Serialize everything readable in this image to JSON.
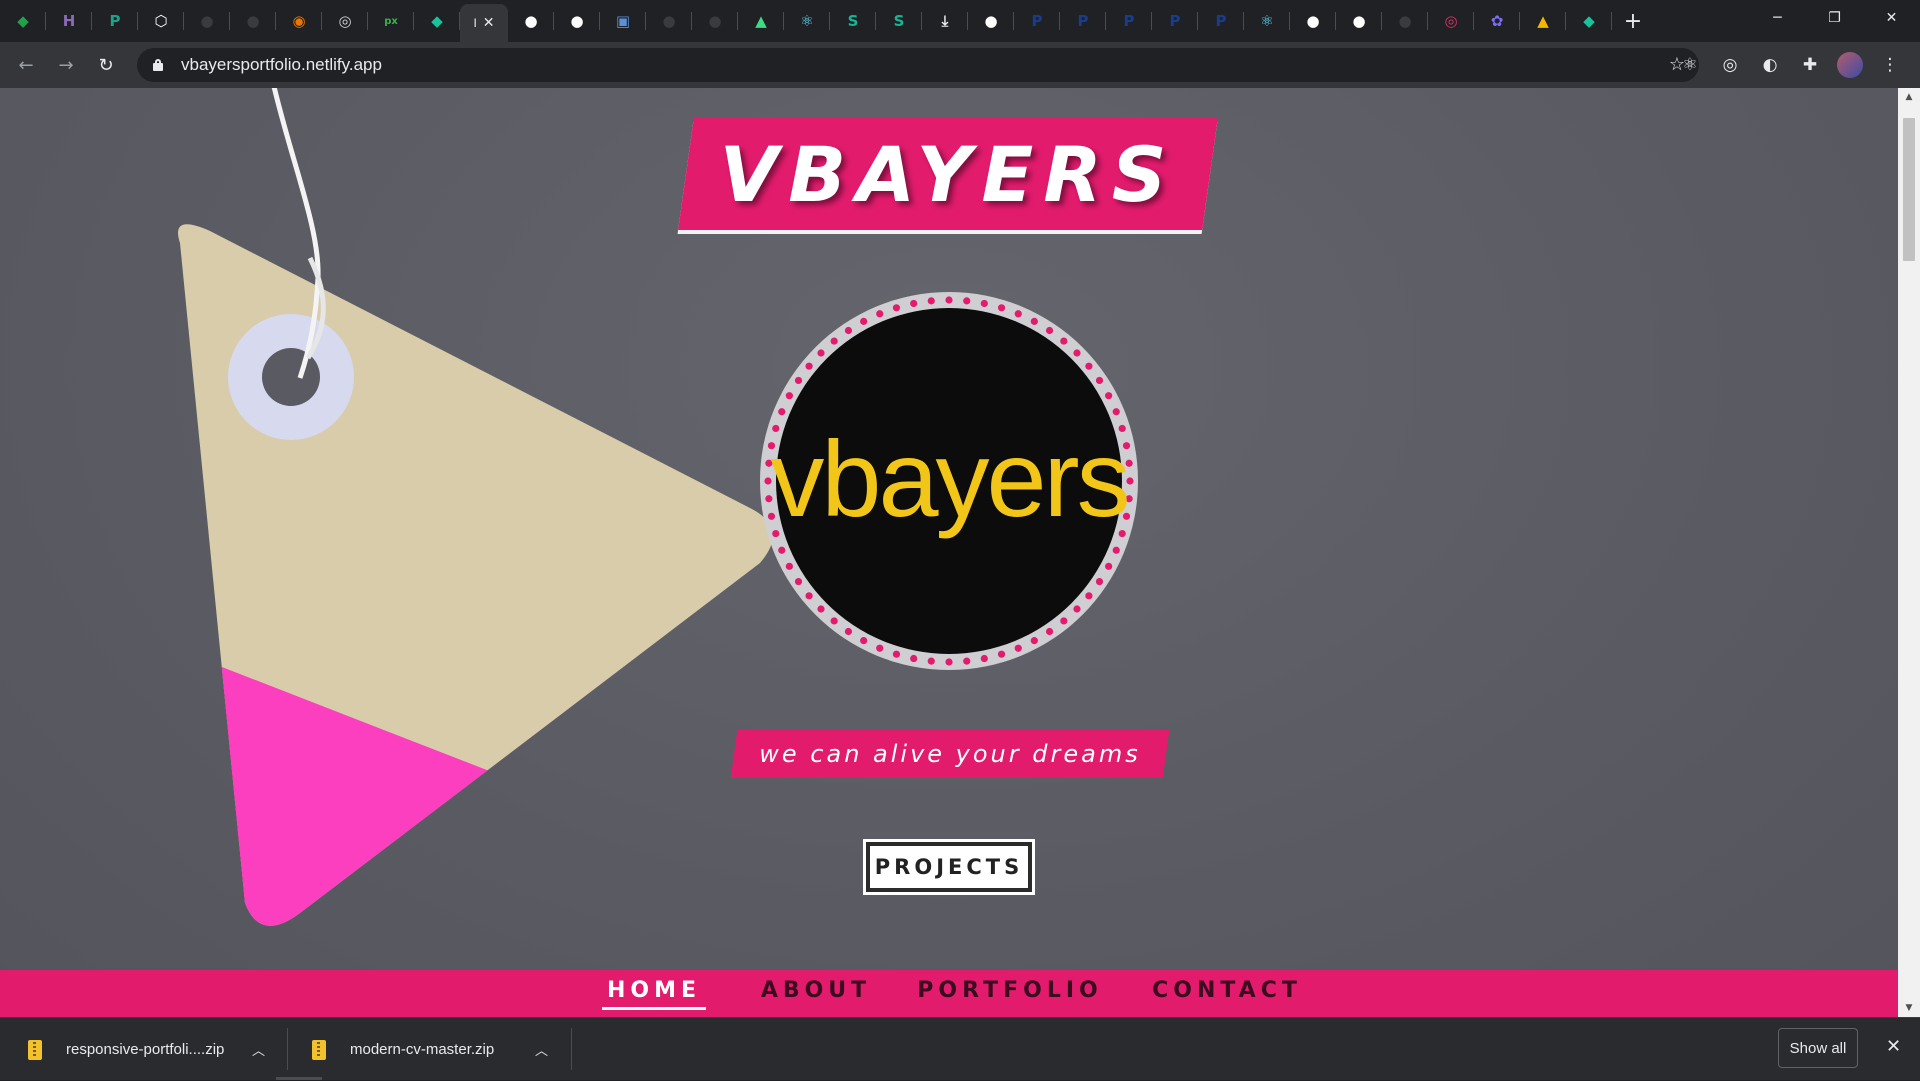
{
  "browser": {
    "tabs": [
      {
        "icon": "mongodb-leaf-icon",
        "color": "#21a24a",
        "glyph": "◆"
      },
      {
        "icon": "heroku-icon",
        "color": "#8a6bb8",
        "glyph": "H"
      },
      {
        "icon": "app-icon",
        "color": "#1fa08a",
        "glyph": "P"
      },
      {
        "icon": "codepen-icon",
        "color": "#ffffff",
        "glyph": "⬡"
      },
      {
        "icon": "github-icon",
        "color": "#3a3b3e",
        "glyph": "●"
      },
      {
        "icon": "github-icon",
        "color": "#3a3b3e",
        "glyph": "●"
      },
      {
        "icon": "blender-icon",
        "color": "#ea7600",
        "glyph": "◉"
      },
      {
        "icon": "spiral-icon",
        "color": "#cfd3d8",
        "glyph": "◎"
      },
      {
        "icon": "pixel-icon",
        "color": "#3bb24a",
        "glyph": "px"
      },
      {
        "icon": "diamond-icon",
        "color": "#19c39c",
        "glyph": "◆"
      },
      {
        "icon": "globe-icon",
        "color": "#ffffff",
        "glyph": "●"
      },
      {
        "icon": "globe-icon",
        "color": "#ffffff",
        "glyph": "●"
      },
      {
        "icon": "photo-icon",
        "color": "#5b8fd6",
        "glyph": "▣"
      },
      {
        "icon": "github-icon",
        "color": "#3a3b3e",
        "glyph": "●"
      },
      {
        "icon": "github-icon",
        "color": "#3a3b3e",
        "glyph": "●"
      },
      {
        "icon": "android-icon",
        "color": "#3ddc84",
        "glyph": "▲"
      },
      {
        "icon": "react-icon",
        "color": "#61dafb",
        "glyph": "⚛"
      },
      {
        "icon": "stackblitz-icon",
        "color": "#1ab394",
        "glyph": "S"
      },
      {
        "icon": "stackblitz-icon",
        "color": "#1ab394",
        "glyph": "S"
      },
      {
        "icon": "download-icon",
        "color": "#e8eaed",
        "glyph": "⤓"
      },
      {
        "icon": "globe-icon",
        "color": "#ffffff",
        "glyph": "●"
      },
      {
        "icon": "paypal-icon",
        "color": "#1a3c8c",
        "glyph": "P"
      },
      {
        "icon": "paypal-icon",
        "color": "#1a3c8c",
        "glyph": "P"
      },
      {
        "icon": "paypal-icon",
        "color": "#1a3c8c",
        "glyph": "P"
      },
      {
        "icon": "paypal-icon",
        "color": "#1a3c8c",
        "glyph": "P"
      },
      {
        "icon": "paypal-icon",
        "color": "#1a3c8c",
        "glyph": "P"
      },
      {
        "icon": "react-icon",
        "color": "#61dafb",
        "glyph": "⚛"
      },
      {
        "icon": "globe-icon",
        "color": "#ffffff",
        "glyph": "●"
      },
      {
        "icon": "globe-icon",
        "color": "#ffffff",
        "glyph": "●"
      },
      {
        "icon": "github-icon",
        "color": "#3a3b3e",
        "glyph": "●"
      },
      {
        "icon": "instagram-icon",
        "color": "#e1306c",
        "glyph": "◎"
      },
      {
        "icon": "cluster-icon",
        "color": "#7b6cf6",
        "glyph": "✿"
      },
      {
        "icon": "google-drive-icon",
        "color": "#f4b400",
        "glyph": "▲"
      },
      {
        "icon": "diamond-icon",
        "color": "#19c39c",
        "glyph": "◆"
      }
    ],
    "active_tab_label": "I",
    "url": "vbayersportfolio.netlify.app"
  },
  "page": {
    "brand": "VBAYERS",
    "logo_text": "vbayers",
    "tagline": "we can alive your dreams",
    "cta_label": "PROJECTS",
    "nav": [
      {
        "label": "HOME",
        "active": true
      },
      {
        "label": "ABOUT",
        "active": false
      },
      {
        "label": "PORTFOLIO",
        "active": false
      },
      {
        "label": "CONTACT",
        "active": false
      }
    ],
    "colors": {
      "accent": "#e31b6d",
      "logo": "#f2c618",
      "background": "#5a5a62"
    }
  },
  "downloads": {
    "items": [
      {
        "name": "responsive-portfoli....zip"
      },
      {
        "name": "modern-cv-master.zip"
      }
    ],
    "show_all_label": "Show all"
  }
}
